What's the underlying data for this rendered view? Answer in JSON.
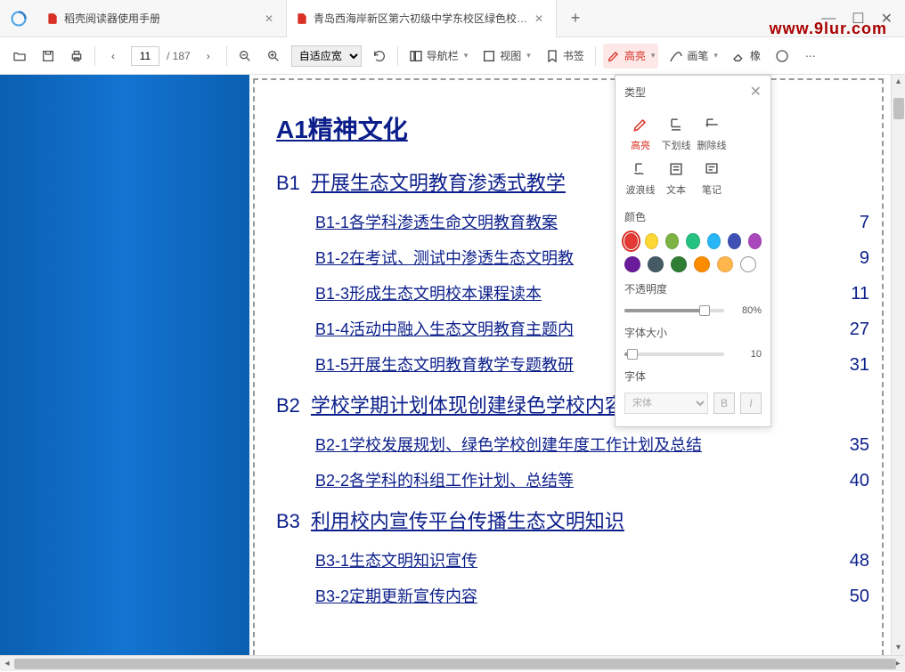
{
  "watermark": "www.9lur.com",
  "tabs": [
    {
      "title": "稻壳阅读器使用手册",
      "active": false
    },
    {
      "title": "青岛西海岸新区第六初级中学东校区绿色校…",
      "active": true
    }
  ],
  "toolbar": {
    "page_current": "11",
    "page_total": "/ 187",
    "zoom": "自适应宽",
    "nav_label": "导航栏",
    "view_label": "视图",
    "bookmark_label": "书签",
    "highlight_label": "高亮",
    "pen_label": "画笔",
    "eraser_label": "橡"
  },
  "doc": {
    "h1": "A1精神文化",
    "sections": [
      {
        "code": "B1",
        "title": "开展生态文明教育渗透式教学",
        "items": [
          {
            "link": "B1-1各学科渗透生命文明教育教案",
            "num": "7"
          },
          {
            "link": "B1-2在考试、测试中渗透生态文明教",
            "num": "9"
          },
          {
            "link": "B1-3形成生态文明校本课程读本",
            "num": "11"
          },
          {
            "link": "B1-4活动中融入生态文明教育主题内",
            "num": "27"
          },
          {
            "link": "B1-5开展生态文明教育教学专题教研",
            "num": "31"
          }
        ]
      },
      {
        "code": "B2",
        "title": "学校学期计划体现创建绿色学校内容",
        "items": [
          {
            "link": "B2-1学校发展规划、绿色学校创建年度工作计划及总结",
            "num": "35"
          },
          {
            "link": "B2-2各学科的科组工作计划、总结等",
            "num": "40"
          }
        ]
      },
      {
        "code": "B3",
        "title": "利用校内宣传平台传播生态文明知识",
        "items": [
          {
            "link": "B3-1生态文明知识宣传",
            "num": "48"
          },
          {
            "link": "B3-2定期更新宣传内容",
            "num": "50"
          }
        ]
      }
    ]
  },
  "panel": {
    "type_label": "类型",
    "types": [
      {
        "name": "高亮",
        "active": true
      },
      {
        "name": "下划线",
        "active": false
      },
      {
        "name": "删除线",
        "active": false
      },
      {
        "name": "波浪线",
        "active": false
      },
      {
        "name": "文本",
        "active": false
      },
      {
        "name": "笔记",
        "active": false
      }
    ],
    "color_label": "颜色",
    "colors_row1": [
      "#e53935",
      "#fdd835",
      "#7cb342",
      "#26c281",
      "#29b6f6",
      "#3f51b5",
      "#ab47bc"
    ],
    "colors_row2": [
      "#6a1b9a",
      "#455a64",
      "#2e7d32",
      "#fb8c00",
      "#ffb74d"
    ],
    "opacity_label": "不透明度",
    "opacity_value": "80%",
    "opacity_pct": 80,
    "fontsize_label": "字体大小",
    "fontsize_value": "10",
    "fontsize_pct": 8,
    "font_label": "字体",
    "font_value": "宋体",
    "bold": "B",
    "italic": "I"
  }
}
